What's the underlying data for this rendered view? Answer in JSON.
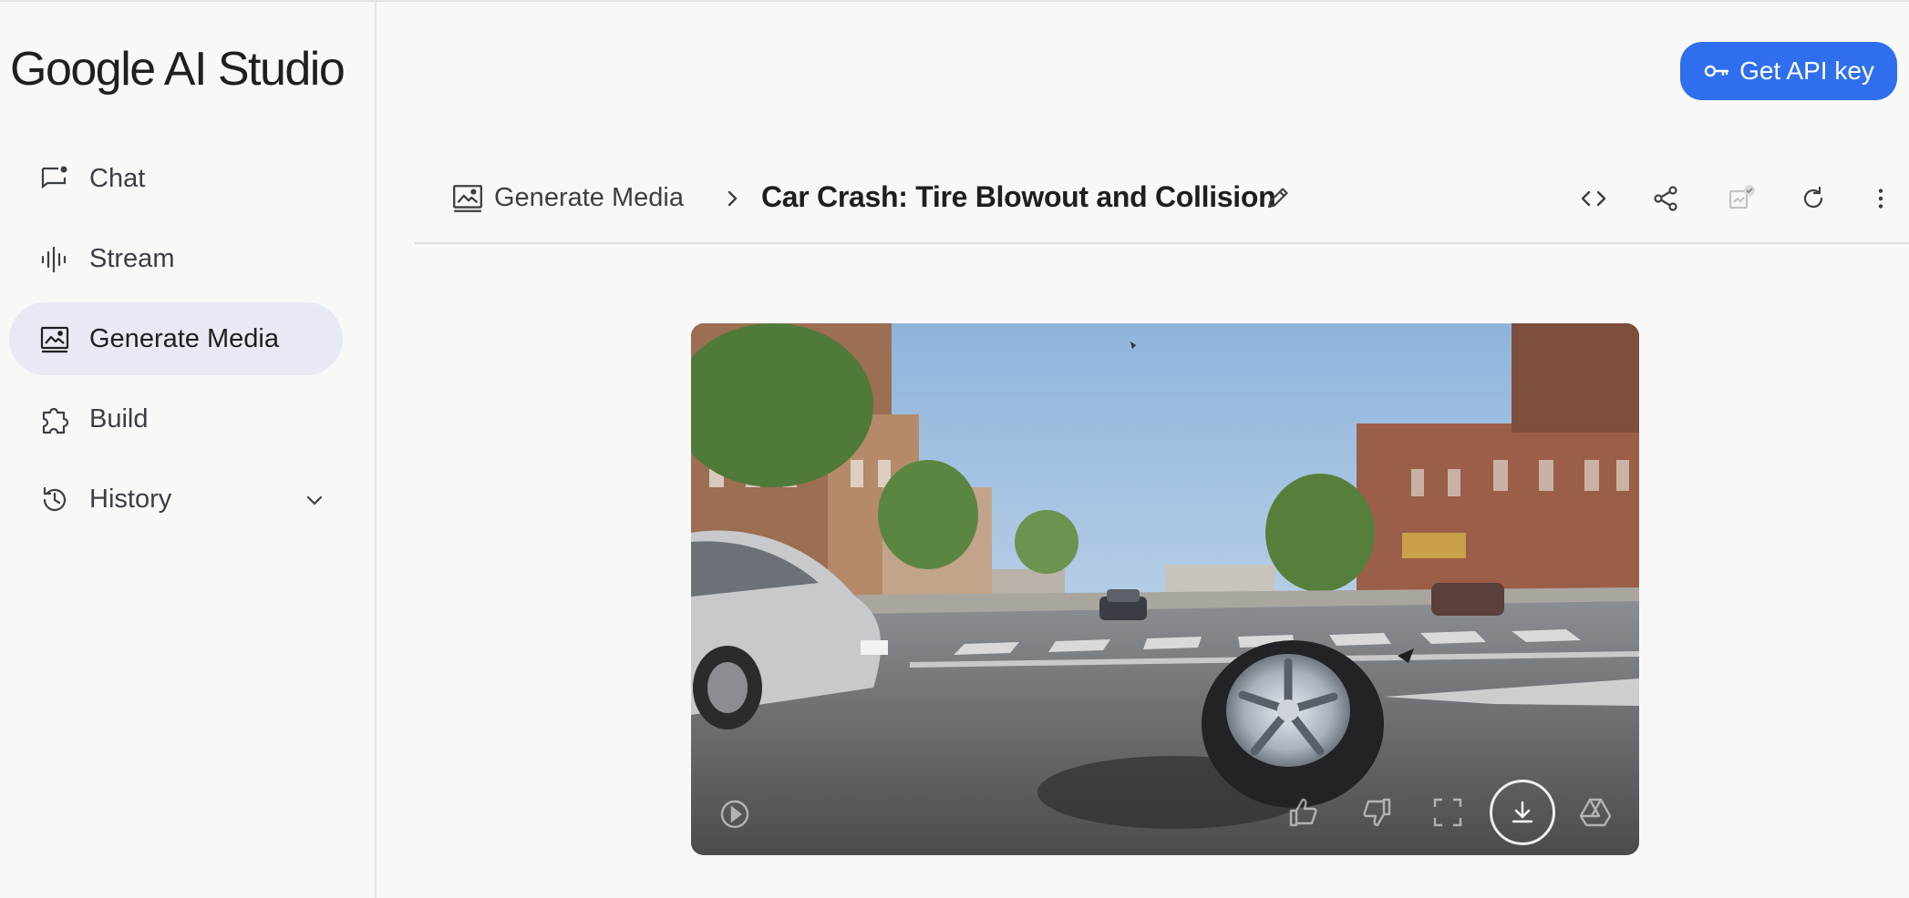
{
  "app": {
    "logo_text": "Google AI Studio",
    "get_api_key_label": "Get API key"
  },
  "sidebar": {
    "items": [
      {
        "label": "Chat",
        "icon": "chat-icon",
        "active": false
      },
      {
        "label": "Stream",
        "icon": "waveform-icon",
        "active": false
      },
      {
        "label": "Generate Media",
        "icon": "image-icon",
        "active": true
      },
      {
        "label": "Build",
        "icon": "puzzle-icon",
        "active": false
      },
      {
        "label": "History",
        "icon": "history-icon",
        "active": false,
        "expandable": true
      }
    ]
  },
  "header": {
    "breadcrumb_parent": "Generate Media",
    "title": "Car Crash: Tire Blowout and Collision",
    "actions": [
      "code-icon",
      "share-icon",
      "compare-icon",
      "refresh-icon",
      "more-vert-icon"
    ]
  },
  "video": {
    "controls": [
      "play-icon",
      "thumb-up-icon",
      "thumb-down-icon",
      "fullscreen-icon",
      "download-icon",
      "drive-icon"
    ]
  },
  "colors": {
    "accent": "#2f6fed",
    "active_nav_bg": "#e8eaf3",
    "sidebar_bg": "#f8f8f7"
  }
}
